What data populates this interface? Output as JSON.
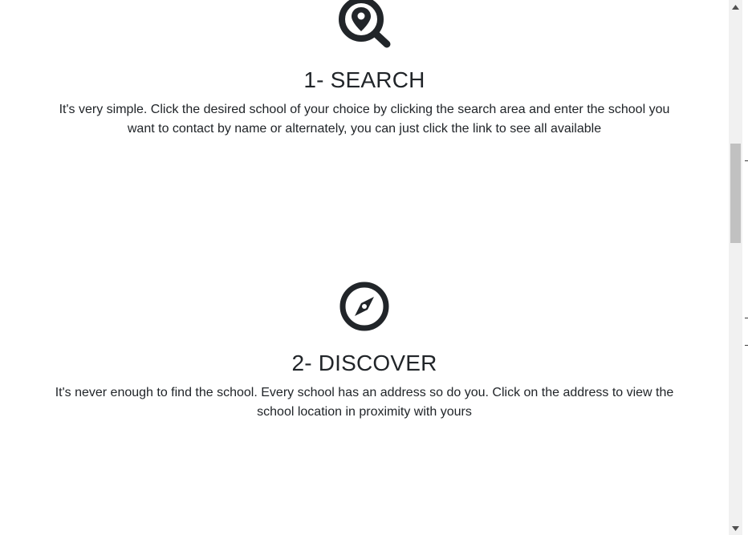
{
  "steps": [
    {
      "icon": "map-pin-search-icon",
      "title": "1- SEARCH",
      "text": "It's very simple. Click the desired school of your choice by clicking the search area and enter the school you want to contact by name or alternately, you can just click the link to see all available"
    },
    {
      "icon": "compass-icon",
      "title": "2- DISCOVER",
      "text": "It's never enough to find the school. Every school has an address so do you. Click on the address to view the school location in proximity with yours"
    }
  ],
  "scrollbar": {
    "up_icon": "scroll-up-arrow-icon",
    "down_icon": "scroll-down-arrow-icon"
  },
  "colors": {
    "text": "#212529",
    "icon": "#212529",
    "scroll_track": "#f1f1f1",
    "scroll_thumb": "#c1c1c1"
  }
}
